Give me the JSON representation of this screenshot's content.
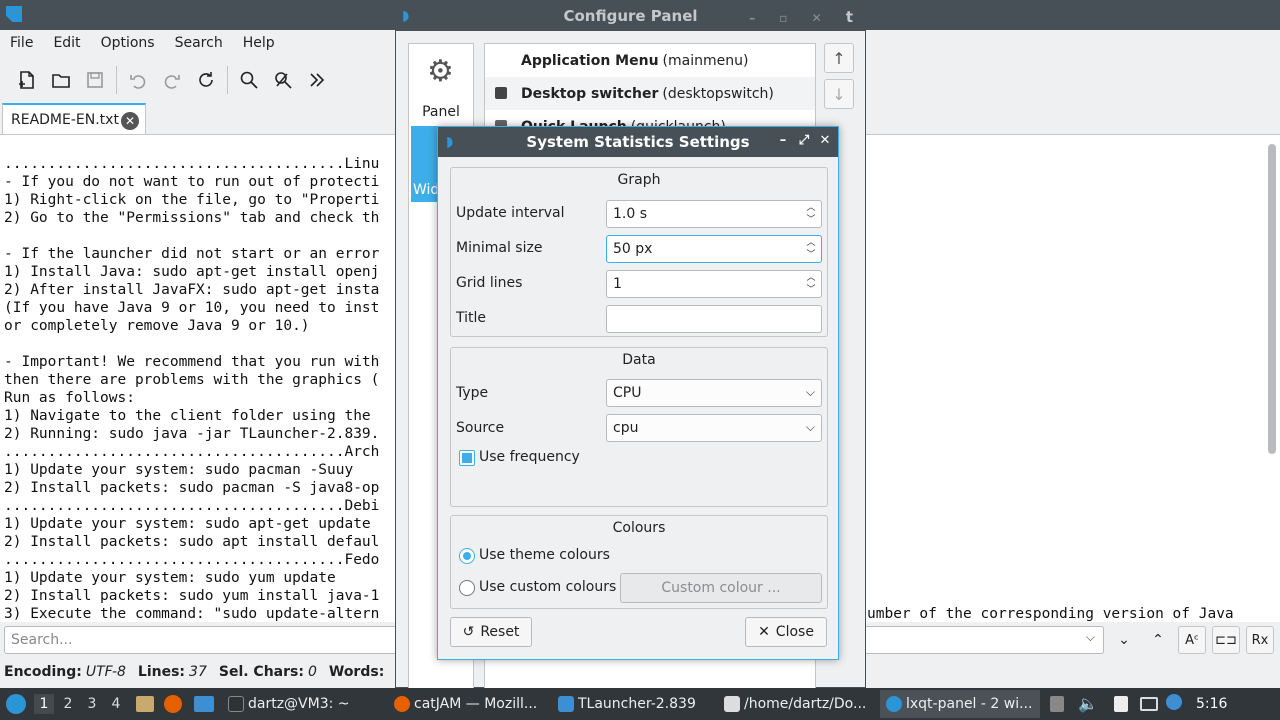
{
  "editor": {
    "menu": [
      "File",
      "Edit",
      "Options",
      "Search",
      "Help"
    ],
    "tab_label": "README-EN.txt",
    "text_lines": [
      ".......................................Linu",
      "- If you do not want to run out of protecti",
      "1) Right-click on the file, go to \"Properti",
      "2) Go to the \"Permissions\" tab and check th",
      "",
      "- If the launcher did not start or an error",
      "1) Install Java: sudo apt-get install openj",
      "2) After install JavaFX: sudo apt-get insta",
      "(If you have Java 9 or 10, you need to inst",
      "or completely remove Java 9 or 10.)",
      "",
      "- Important! We recommend that you run with",
      "then there are problems with the graphics (",
      "Run as follows:",
      "1) Navigate to the client folder using the ",
      "2) Running: sudo java -jar TLauncher-2.839.",
      ".......................................Arch",
      "1) Update your system: sudo pacman -Suuy",
      "2) Install packets: sudo pacman -S java8-op",
      ".......................................Debi",
      "1) Update your system: sudo apt-get update",
      "2) Install packets: sudo apt install defaul",
      ".......................................Fedo",
      "1) Update your system: sudo yum update",
      "2) Install packets: sudo yum install java-1",
      "3) Execute the command: \"sudo update-altern"
    ],
    "text_tail": "umber of the corresponding version of Java",
    "search_placeholder": "Search...",
    "status": {
      "encoding_label": "Encoding:",
      "encoding_value": "UTF-8",
      "lines_label": "Lines:",
      "lines_value": "37",
      "sel_label": "Sel. Chars:",
      "sel_value": "0",
      "words_label": "Words:"
    }
  },
  "configure_panel": {
    "title": "Configure Panel",
    "title_tail": "t",
    "side_panel_label": "Panel",
    "side_widgets_label": "Wid",
    "widgets": [
      {
        "name": "Application Menu",
        "id": "(mainmenu)"
      },
      {
        "name": "Desktop switcher",
        "id": "(desktopswitch)"
      },
      {
        "name": "Quick Launch",
        "id": "(quicklaunch)"
      }
    ]
  },
  "dialog": {
    "title": "System Statistics Settings",
    "graph": {
      "title": "Graph",
      "update_interval_label": "Update interval",
      "update_interval_value": "1.0 s",
      "minimal_size_label": "Minimal size",
      "minimal_size_value": "50 px",
      "grid_lines_label": "Grid lines",
      "grid_lines_value": "1",
      "title_label": "Title",
      "title_value": ""
    },
    "data": {
      "title": "Data",
      "type_label": "Type",
      "type_value": "CPU",
      "source_label": "Source",
      "source_value": "cpu",
      "use_frequency_label": "Use frequency",
      "use_frequency_checked": true
    },
    "colours": {
      "title": "Colours",
      "theme_label": "Use theme colours",
      "custom_label": "Use custom colours",
      "custom_button": "Custom colour ...",
      "selected": "theme"
    },
    "reset_label": "Reset",
    "close_label": "Close"
  },
  "taskbar": {
    "desktops": [
      "1",
      "2",
      "3",
      "4"
    ],
    "active_desktop": "1",
    "tasks": [
      {
        "label": "dartz@VM3: ~",
        "color": "#2e3436"
      },
      {
        "label": "catJAM — Mozill...",
        "color": "#e66000"
      },
      {
        "label": "TLauncher-2.839",
        "color": "#3d8fd1"
      },
      {
        "label": "/home/dartz/Do...",
        "color": "#dddddd"
      },
      {
        "label": "lxqt-panel - 2 wi...",
        "color": "#2b95d6"
      }
    ],
    "clock": "5:16"
  },
  "colors": {
    "accent": "#3daee9",
    "titlebar": "#475057",
    "taskbar": "#31363b"
  }
}
